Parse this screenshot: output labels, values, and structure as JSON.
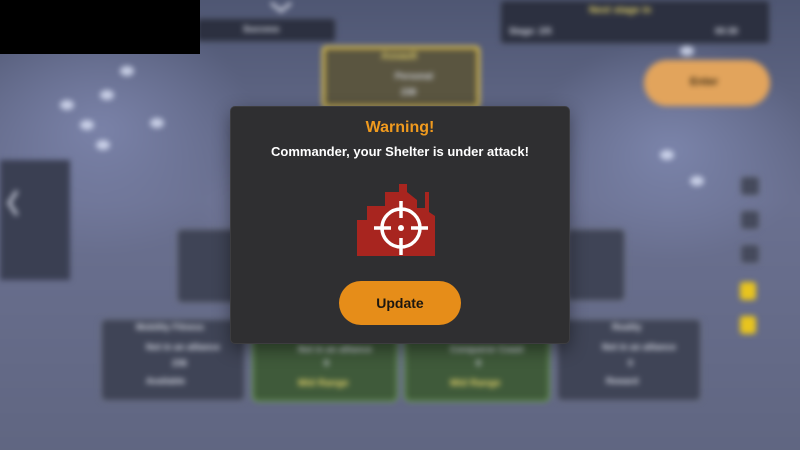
{
  "modal": {
    "title": "Warning!",
    "message": "Commander, your Shelter is under attack!",
    "icon": "shelter-under-attack-icon",
    "button_label": "Update"
  },
  "colors": {
    "modal_bg": "#2f2f31",
    "title": "#f09a1e",
    "icon_red": "#a8251f",
    "button": "#e68d19",
    "button_text": "#1c1710"
  },
  "background": {
    "tab_label": "Success",
    "stage_title": "Next stage in",
    "stage_label": "Stage: 2/5",
    "timer": "00:30",
    "action_button": "Enter",
    "top_card": {
      "title": "Assault",
      "name": "Personal",
      "value": "238"
    },
    "bottom_cards": [
      {
        "title": "Mobility Fitness",
        "name": "Not in an alliance",
        "value": "236",
        "status": "Available"
      },
      {
        "title": "",
        "name": "Not in an alliance",
        "value": "0",
        "status": "Mid Range"
      },
      {
        "title": "",
        "name": "Conqueror Coast",
        "value": "0",
        "status": "Mid Range"
      },
      {
        "title": "Reality",
        "name": "Not in an alliance",
        "value": "0",
        "status": "Reward"
      }
    ]
  }
}
